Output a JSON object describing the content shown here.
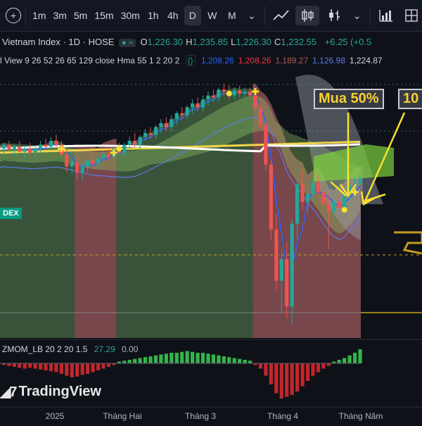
{
  "toolbar": {
    "add_symbol": "+",
    "intervals": [
      "1m",
      "3m",
      "5m",
      "15m",
      "30m",
      "1h",
      "4h",
      "D",
      "W",
      "M"
    ],
    "active_interval": "D",
    "more": "⌄"
  },
  "header": {
    "title": "Vietnam Index · 1D · HOSE",
    "ohlc": [
      {
        "k": "O",
        "v": "1,226.30"
      },
      {
        "k": "H",
        "v": "1,235.85"
      },
      {
        "k": "L",
        "v": "1,226.30"
      },
      {
        "k": "C",
        "v": "1,232.55"
      }
    ],
    "change": "+6.25 (+0.5"
  },
  "indicator_legend": {
    "label": "l View 9 26 52 26 65 129 close Hma 55 1 2 20 2",
    "values": [
      {
        "v": "1,208.26",
        "color": "#2962ff"
      },
      {
        "v": "1,208.26",
        "color": "#f23645"
      },
      {
        "v": "1,189.27",
        "color": "#b05b55"
      },
      {
        "v": "1,126.98",
        "color": "#5d7be8"
      },
      {
        "v": "1,224.87",
        "color": "#d1d4dc"
      }
    ]
  },
  "zmom": {
    "label": "ZMOM_LB 20 2 20 1.5",
    "value": "27.29",
    "value2": "0.00"
  },
  "annotations": {
    "buy1": "Mua 50%",
    "buy2": "10"
  },
  "dex_label": "DEX",
  "logo": "TradingView",
  "x_axis": [
    {
      "label": "2025",
      "pos": 0.13
    },
    {
      "label": "Tháng Hai",
      "pos": 0.29
    },
    {
      "label": "Tháng 3",
      "pos": 0.475
    },
    {
      "label": "Tháng 4",
      "pos": 0.67
    },
    {
      "label": "Tháng Năm",
      "pos": 0.855
    }
  ],
  "chart_data": {
    "type": "candlestick",
    "title": "Vietnam Index · 1D · HOSE",
    "y_range": [
      1070,
      1345
    ],
    "x_ticks": [
      "2025",
      "Tháng Hai",
      "Tháng 3",
      "Tháng 4",
      "Tháng Năm"
    ],
    "candles": [
      {
        "o": 1265,
        "h": 1272,
        "l": 1258,
        "c": 1262
      },
      {
        "o": 1262,
        "h": 1268,
        "l": 1256,
        "c": 1266
      },
      {
        "o": 1266,
        "h": 1270,
        "l": 1260,
        "c": 1261
      },
      {
        "o": 1261,
        "h": 1266,
        "l": 1255,
        "c": 1264
      },
      {
        "o": 1264,
        "h": 1270,
        "l": 1258,
        "c": 1259
      },
      {
        "o": 1259,
        "h": 1264,
        "l": 1252,
        "c": 1262
      },
      {
        "o": 1262,
        "h": 1268,
        "l": 1256,
        "c": 1258
      },
      {
        "o": 1258,
        "h": 1264,
        "l": 1252,
        "c": 1262
      },
      {
        "o": 1262,
        "h": 1270,
        "l": 1258,
        "c": 1266
      },
      {
        "o": 1266,
        "h": 1272,
        "l": 1261,
        "c": 1264
      },
      {
        "o": 1264,
        "h": 1274,
        "l": 1260,
        "c": 1270
      },
      {
        "o": 1270,
        "h": 1276,
        "l": 1264,
        "c": 1266
      },
      {
        "o": 1266,
        "h": 1270,
        "l": 1252,
        "c": 1256
      },
      {
        "o": 1256,
        "h": 1262,
        "l": 1238,
        "c": 1244
      },
      {
        "o": 1244,
        "h": 1252,
        "l": 1236,
        "c": 1248
      },
      {
        "o": 1248,
        "h": 1254,
        "l": 1232,
        "c": 1238
      },
      {
        "o": 1238,
        "h": 1248,
        "l": 1230,
        "c": 1244
      },
      {
        "o": 1244,
        "h": 1252,
        "l": 1238,
        "c": 1250
      },
      {
        "o": 1250,
        "h": 1256,
        "l": 1244,
        "c": 1247
      },
      {
        "o": 1247,
        "h": 1254,
        "l": 1242,
        "c": 1252
      },
      {
        "o": 1252,
        "h": 1260,
        "l": 1248,
        "c": 1256
      },
      {
        "o": 1256,
        "h": 1262,
        "l": 1250,
        "c": 1254
      },
      {
        "o": 1254,
        "h": 1264,
        "l": 1250,
        "c": 1262
      },
      {
        "o": 1262,
        "h": 1268,
        "l": 1256,
        "c": 1258
      },
      {
        "o": 1258,
        "h": 1268,
        "l": 1254,
        "c": 1266
      },
      {
        "o": 1266,
        "h": 1274,
        "l": 1262,
        "c": 1270
      },
      {
        "o": 1270,
        "h": 1278,
        "l": 1264,
        "c": 1266
      },
      {
        "o": 1266,
        "h": 1276,
        "l": 1262,
        "c": 1274
      },
      {
        "o": 1274,
        "h": 1282,
        "l": 1270,
        "c": 1278
      },
      {
        "o": 1278,
        "h": 1284,
        "l": 1272,
        "c": 1276
      },
      {
        "o": 1276,
        "h": 1286,
        "l": 1272,
        "c": 1284
      },
      {
        "o": 1284,
        "h": 1292,
        "l": 1278,
        "c": 1288
      },
      {
        "o": 1288,
        "h": 1294,
        "l": 1280,
        "c": 1284
      },
      {
        "o": 1284,
        "h": 1296,
        "l": 1280,
        "c": 1292
      },
      {
        "o": 1292,
        "h": 1300,
        "l": 1286,
        "c": 1298
      },
      {
        "o": 1298,
        "h": 1304,
        "l": 1292,
        "c": 1296
      },
      {
        "o": 1296,
        "h": 1306,
        "l": 1292,
        "c": 1304
      },
      {
        "o": 1304,
        "h": 1312,
        "l": 1298,
        "c": 1308
      },
      {
        "o": 1308,
        "h": 1314,
        "l": 1300,
        "c": 1304
      },
      {
        "o": 1304,
        "h": 1316,
        "l": 1300,
        "c": 1312
      },
      {
        "o": 1312,
        "h": 1320,
        "l": 1306,
        "c": 1316
      },
      {
        "o": 1316,
        "h": 1322,
        "l": 1310,
        "c": 1314
      },
      {
        "o": 1314,
        "h": 1324,
        "l": 1310,
        "c": 1322
      },
      {
        "o": 1322,
        "h": 1328,
        "l": 1316,
        "c": 1320
      },
      {
        "o": 1320,
        "h": 1326,
        "l": 1312,
        "c": 1316
      },
      {
        "o": 1316,
        "h": 1324,
        "l": 1312,
        "c": 1321
      },
      {
        "o": 1321,
        "h": 1326,
        "l": 1314,
        "c": 1318
      },
      {
        "o": 1318,
        "h": 1324,
        "l": 1314,
        "c": 1320
      },
      {
        "o": 1320,
        "h": 1324,
        "l": 1312,
        "c": 1316
      },
      {
        "o": 1316,
        "h": 1320,
        "l": 1300,
        "c": 1304
      },
      {
        "o": 1304,
        "h": 1310,
        "l": 1282,
        "c": 1286
      },
      {
        "o": 1286,
        "h": 1290,
        "l": 1240,
        "c": 1246
      },
      {
        "o": 1246,
        "h": 1250,
        "l": 1170,
        "c": 1180
      },
      {
        "o": 1180,
        "h": 1196,
        "l": 1118,
        "c": 1128
      },
      {
        "o": 1128,
        "h": 1160,
        "l": 1095,
        "c": 1150
      },
      {
        "o": 1150,
        "h": 1168,
        "l": 1090,
        "c": 1102
      },
      {
        "o": 1102,
        "h": 1190,
        "l": 1084,
        "c": 1186
      },
      {
        "o": 1186,
        "h": 1232,
        "l": 1170,
        "c": 1226
      },
      {
        "o": 1226,
        "h": 1240,
        "l": 1200,
        "c": 1208
      },
      {
        "o": 1208,
        "h": 1222,
        "l": 1196,
        "c": 1216
      },
      {
        "o": 1216,
        "h": 1232,
        "l": 1210,
        "c": 1228
      },
      {
        "o": 1228,
        "h": 1236,
        "l": 1214,
        "c": 1218
      },
      {
        "o": 1218,
        "h": 1226,
        "l": 1200,
        "c": 1206
      },
      {
        "o": 1206,
        "h": 1214,
        "l": 1160,
        "c": 1198
      },
      {
        "o": 1198,
        "h": 1212,
        "l": 1190,
        "c": 1208
      },
      {
        "o": 1208,
        "h": 1216,
        "l": 1198,
        "c": 1202
      },
      {
        "o": 1202,
        "h": 1220,
        "l": 1198,
        "c": 1216
      },
      {
        "o": 1216,
        "h": 1228,
        "l": 1210,
        "c": 1224
      },
      {
        "o": 1224,
        "h": 1234,
        "l": 1218,
        "c": 1226
      },
      {
        "o": 1226,
        "h": 1236,
        "l": 1226,
        "c": 1232
      }
    ],
    "momentum": [
      0,
      -2,
      -3,
      -4,
      -5,
      -6,
      -5,
      -6,
      -7,
      -8,
      -9,
      -10,
      -12,
      -14,
      -16,
      -15,
      -13,
      -12,
      -10,
      -8,
      -6,
      -4,
      -2,
      2,
      3,
      4,
      5,
      6,
      7,
      8,
      9,
      10,
      11,
      12,
      12,
      13,
      14,
      13,
      12,
      12,
      11,
      10,
      9,
      8,
      7,
      6,
      5,
      4,
      3,
      -2,
      -6,
      -14,
      -24,
      -34,
      -40,
      -38,
      -36,
      -32,
      -26,
      -20,
      -14,
      -10,
      -6,
      -3,
      2,
      4,
      6,
      9,
      12,
      16
    ]
  }
}
